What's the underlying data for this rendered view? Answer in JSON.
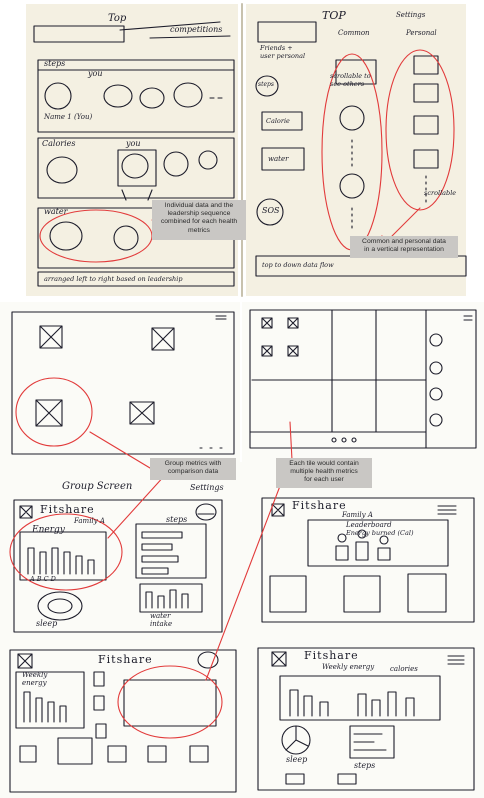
{
  "annotations": {
    "individual_data": "Individual data and the\nleadership sequence\ncombined for each health\nmetrics",
    "common_personal": "Common and personal data\nin a vertical representation",
    "group_metrics": "Group metrics with\ncomparison data",
    "each_tile": "Each tile would contain\nmultiple health metrics\nfor each user"
  },
  "sketch1": {
    "top_label": "Top",
    "competitions": "competitions",
    "steps": "steps",
    "you_steps": "you",
    "name_you": "Name 1 (You)",
    "calories": "Calories",
    "you_cal": "you",
    "water": "water",
    "bottom_note": "arranged left to right based on leadership"
  },
  "sketch2": {
    "top_label": "TOP",
    "friends": "Friends +\nuser personal",
    "common": "Common",
    "personal": "Personal",
    "settings": "Settings",
    "scrollable": "scrollable to\nsee others",
    "steps": "steps",
    "calorie": "Calorie",
    "water": "water",
    "sos": "SOS",
    "scrollable_v": "scrollable",
    "bottom_note": "top to down data flow"
  },
  "sketch5": {
    "group_screen": "Group Screen",
    "settings": "Settings",
    "brand": "Fitshare",
    "family": "Family A",
    "energy": "Energy",
    "steps": "steps",
    "sleep": "sleep",
    "water_intake": "water\nintake",
    "abcd": "A  B  C  D"
  },
  "sketch6": {
    "brand": "Fitshare",
    "family": "Family A",
    "leaderboard": "Leaderboard",
    "energy_burned": "Energy burned (Cal)"
  },
  "sketch7": {
    "brand": "Fitshare",
    "weekly": "Weekly",
    "energy": "energy"
  },
  "sketch8": {
    "brand": "Fitshare",
    "weekly": "Weekly energy",
    "calories": "calories",
    "sleep": "sleep",
    "steps": "steps"
  }
}
